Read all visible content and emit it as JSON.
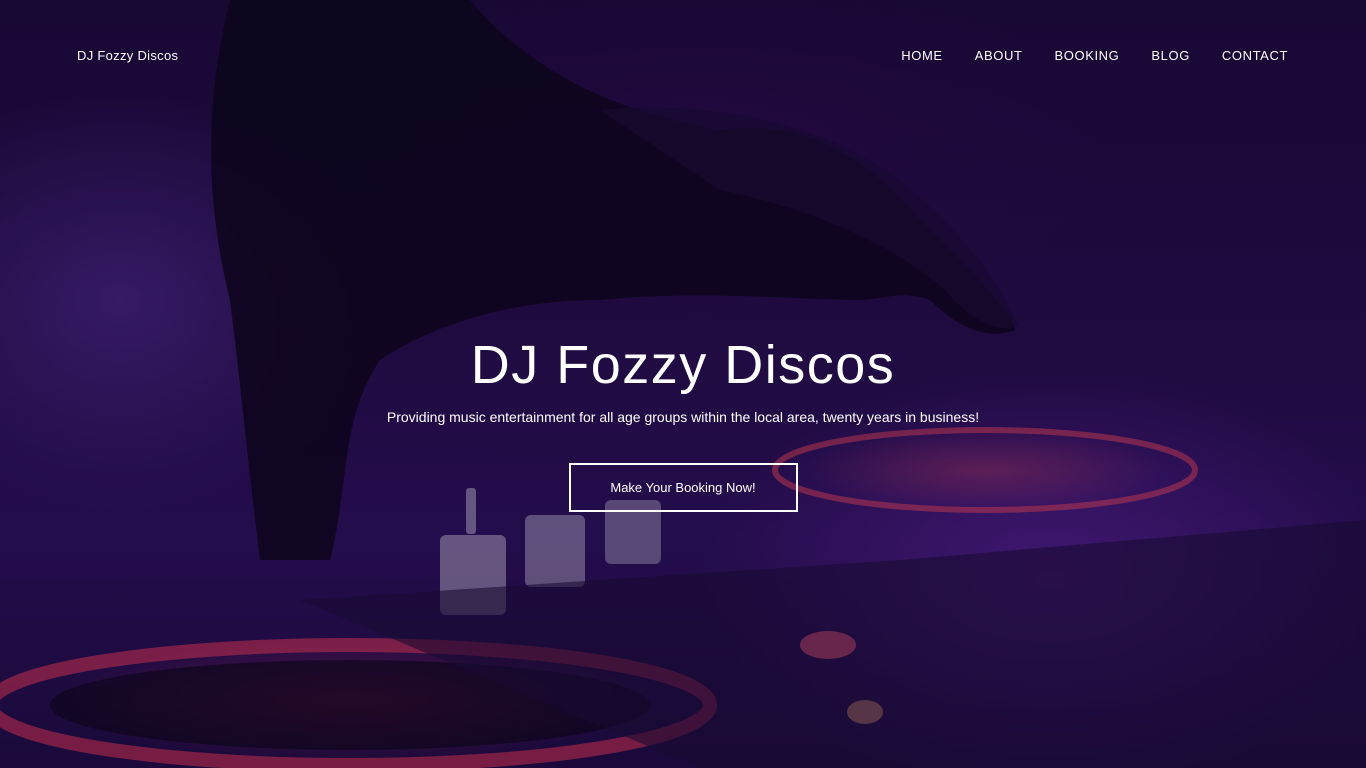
{
  "header": {
    "site_name": "DJ Fozzy Discos",
    "nav": [
      {
        "label": "HOME"
      },
      {
        "label": "ABOUT"
      },
      {
        "label": "BOOKING"
      },
      {
        "label": "BLOG"
      },
      {
        "label": "CONTACT"
      }
    ]
  },
  "hero": {
    "title": "DJ Fozzy Discos",
    "tagline": "Providing music entertainment for all age groups within the local area, twenty years in business!",
    "cta_label": "Make Your Booking Now!",
    "background_image": "dj-hand-on-mixer-purple-photo"
  },
  "colors": {
    "overlay": "#1a0838",
    "accent_purple": "#4a1f8c",
    "accent_red": "#ff3c5a",
    "text": "#ffffff"
  }
}
